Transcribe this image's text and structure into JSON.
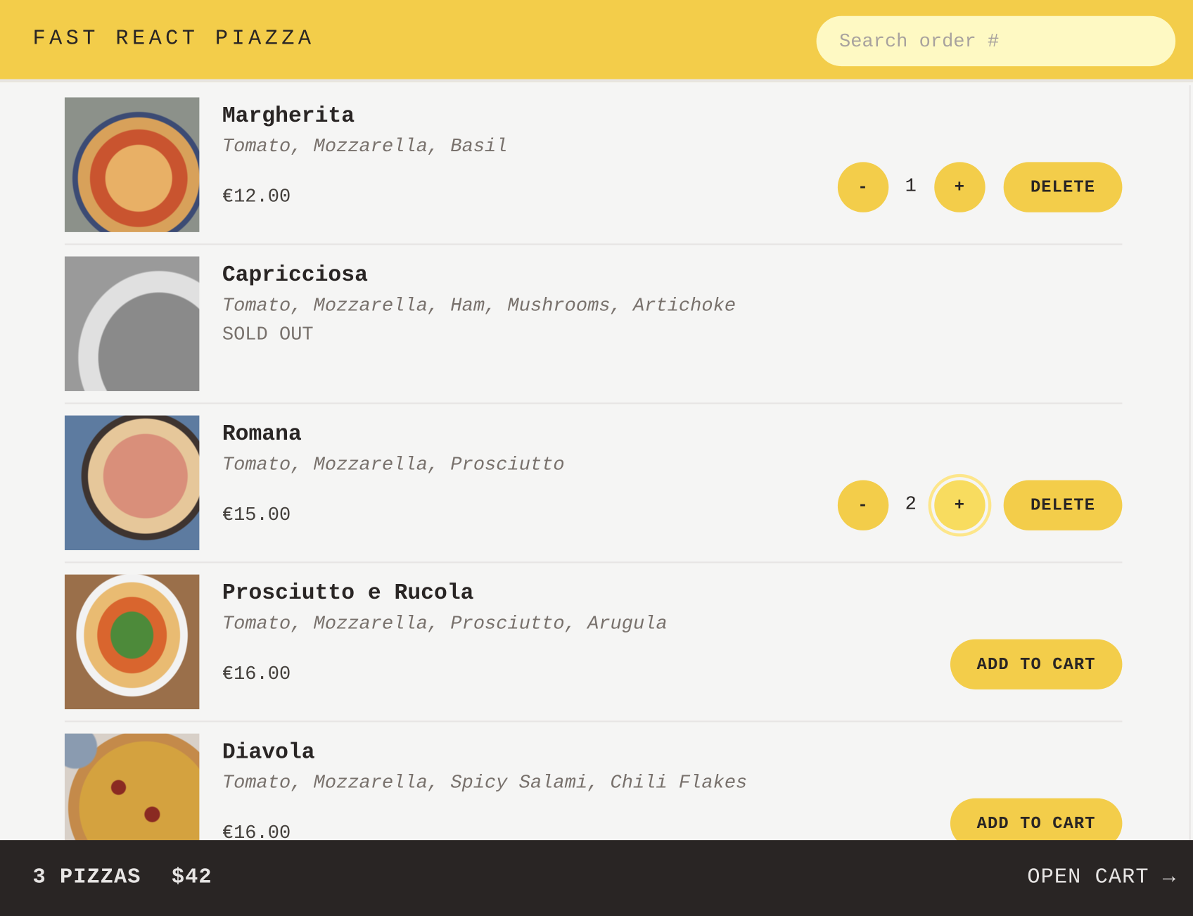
{
  "header": {
    "title": "FAST REACT PIAZZA",
    "search_placeholder": "Search order #",
    "search_value": ""
  },
  "menu": [
    {
      "name": "Margherita",
      "ingredients": "Tomato, Mozzarella, Basil",
      "price": "€12.00",
      "sold_out": false,
      "in_cart": true,
      "quantity": "1"
    },
    {
      "name": "Capricciosa",
      "ingredients": "Tomato, Mozzarella, Ham, Mushrooms, Artichoke",
      "sold_out_label": "SOLD OUT",
      "sold_out": true,
      "in_cart": false
    },
    {
      "name": "Romana",
      "ingredients": "Tomato, Mozzarella, Prosciutto",
      "price": "€15.00",
      "sold_out": false,
      "in_cart": true,
      "quantity": "2"
    },
    {
      "name": "Prosciutto e Rucola",
      "ingredients": "Tomato, Mozzarella, Prosciutto, Arugula",
      "price": "€16.00",
      "sold_out": false,
      "in_cart": false
    },
    {
      "name": "Diavola",
      "ingredients": "Tomato, Mozzarella, Spicy Salami, Chili Flakes",
      "price": "€16.00",
      "sold_out": false,
      "in_cart": false
    }
  ],
  "buttons": {
    "decrease": "-",
    "increase": "+",
    "delete": "DELETE",
    "add_to_cart": "ADD TO CART"
  },
  "cart_overview": {
    "count": "3 PIZZAS",
    "total": "$42",
    "open_cart": "OPEN CART →"
  },
  "colors": {
    "primary": "#f3cd4a",
    "footer": "#292524",
    "background": "#f5f5f4",
    "search_bg": "#fef9c3"
  }
}
